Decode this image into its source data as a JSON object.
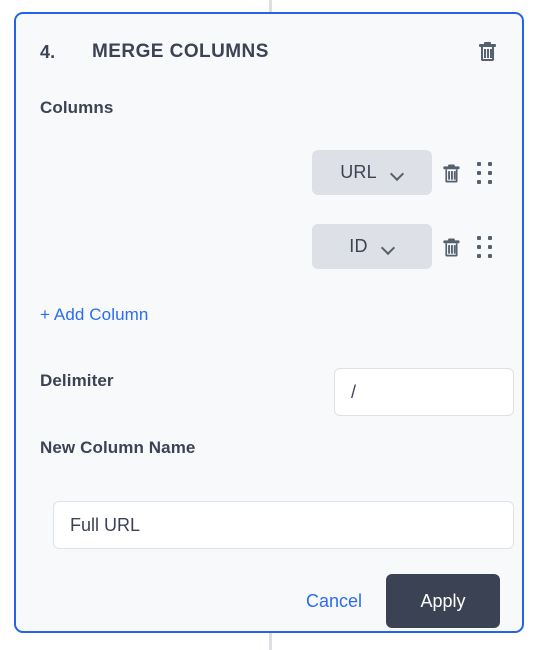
{
  "connector": {
    "color": "#dcdfe4"
  },
  "card": {
    "accent_color": "#2563eb",
    "background_color": "#f8f9fb",
    "header": {
      "step_number": "4.",
      "title": "MERGE COLUMNS",
      "delete_icon": "trash-icon"
    }
  },
  "columns_section": {
    "label": "Columns",
    "rows": [
      {
        "value": "URL",
        "chevron_icon": "chevron-down-icon",
        "delete_icon": "trash-icon",
        "drag_icon": "drag-handle-icon"
      },
      {
        "value": "ID",
        "chevron_icon": "chevron-down-icon",
        "delete_icon": "trash-icon",
        "drag_icon": "drag-handle-icon"
      }
    ],
    "add_column_label": "+ Add Column",
    "add_column_color": "#2b6cf0"
  },
  "delimiter": {
    "label": "Delimiter",
    "value": "/",
    "placeholder": ""
  },
  "new_column": {
    "label": "New Column Name",
    "value": "Full URL",
    "placeholder": ""
  },
  "footer": {
    "cancel_label": "Cancel",
    "cancel_color": "#2b6cf0",
    "apply_label": "Apply",
    "apply_background": "#3a4253"
  }
}
